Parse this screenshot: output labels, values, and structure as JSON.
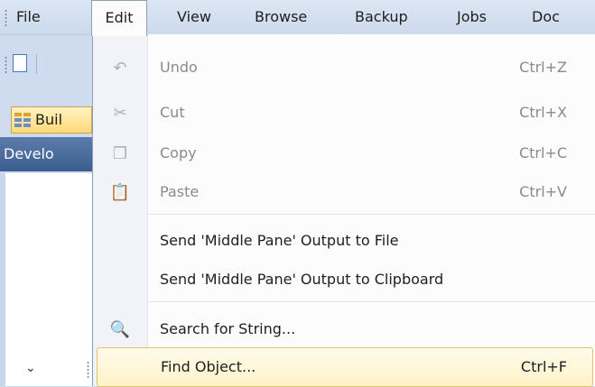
{
  "menubar": {
    "items": [
      {
        "label": "File"
      },
      {
        "label": "Edit"
      },
      {
        "label": "View"
      },
      {
        "label": "Browse"
      },
      {
        "label": "Backup"
      },
      {
        "label": "Jobs"
      },
      {
        "label": "Doc"
      }
    ]
  },
  "left": {
    "build_tab": "Buil",
    "dev_header": "Develo"
  },
  "edit_menu": {
    "items": [
      {
        "label": "Undo",
        "shortcut": "Ctrl+Z",
        "icon": "undo-icon",
        "enabled": false
      },
      {
        "label": "Cut",
        "shortcut": "Ctrl+X",
        "icon": "cut-icon",
        "enabled": false
      },
      {
        "label": "Copy",
        "shortcut": "Ctrl+C",
        "icon": "copy-icon",
        "enabled": false
      },
      {
        "label": "Paste",
        "shortcut": "Ctrl+V",
        "icon": "paste-icon",
        "enabled": false
      },
      {
        "label": "Send 'Middle Pane' Output to File",
        "shortcut": "",
        "enabled": true
      },
      {
        "label": "Send 'Middle Pane' Output to Clipboard",
        "shortcut": "",
        "enabled": true
      },
      {
        "label": "Search for String...",
        "shortcut": "",
        "icon": "search-icon",
        "enabled": true
      },
      {
        "label": "Find Object...",
        "shortcut": "Ctrl+F",
        "enabled": true,
        "highlighted": true
      }
    ]
  }
}
